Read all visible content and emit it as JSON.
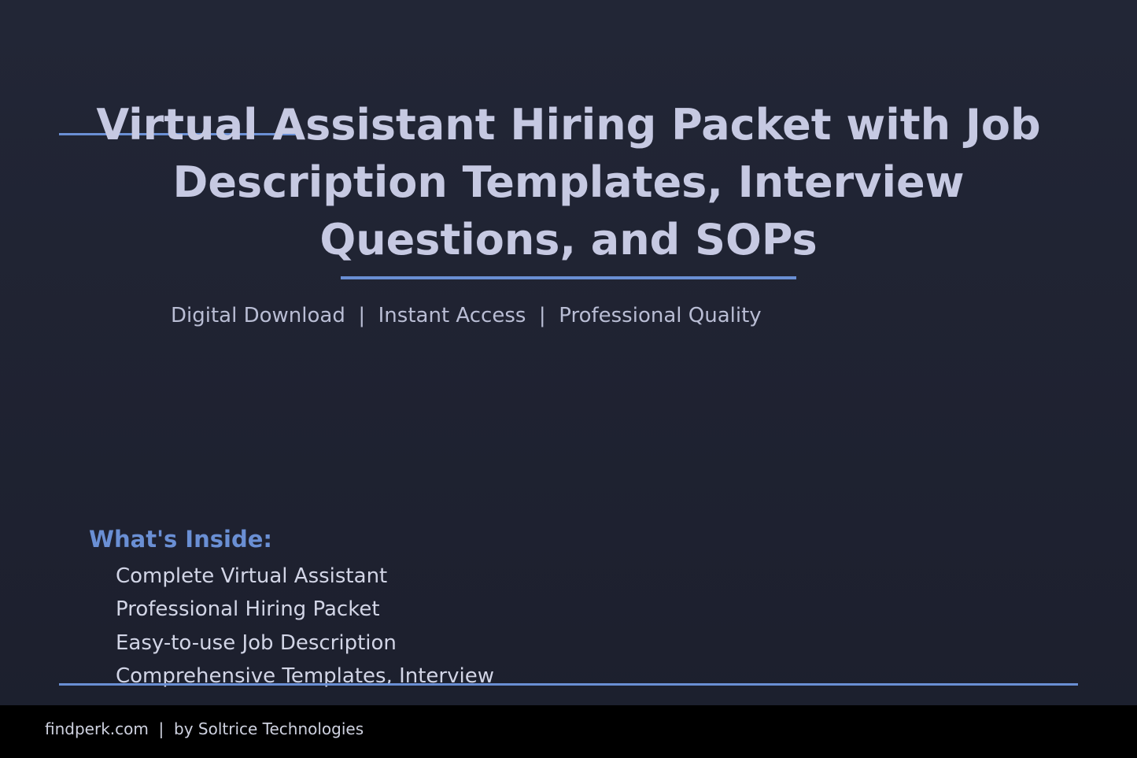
{
  "header": {
    "title": "Virtual Assistant Hiring Packet with Job Description Templates, Interview Questions, and SOPs",
    "tagline": "Digital Download  |  Instant Access  |  Professional Quality"
  },
  "inside": {
    "heading": "What's Inside:",
    "items": [
      "Complete Virtual Assistant",
      "Professional Hiring Packet",
      "Easy-to-use Job Description",
      "Comprehensive Templates, Interview"
    ]
  },
  "footer": {
    "text": "findperk.com  |  by Soltrice Technologies"
  },
  "colors": {
    "background": "#1f2232",
    "accent": "#6a8fd4",
    "title": "#c6c9e2",
    "footer_background": "#000000"
  }
}
